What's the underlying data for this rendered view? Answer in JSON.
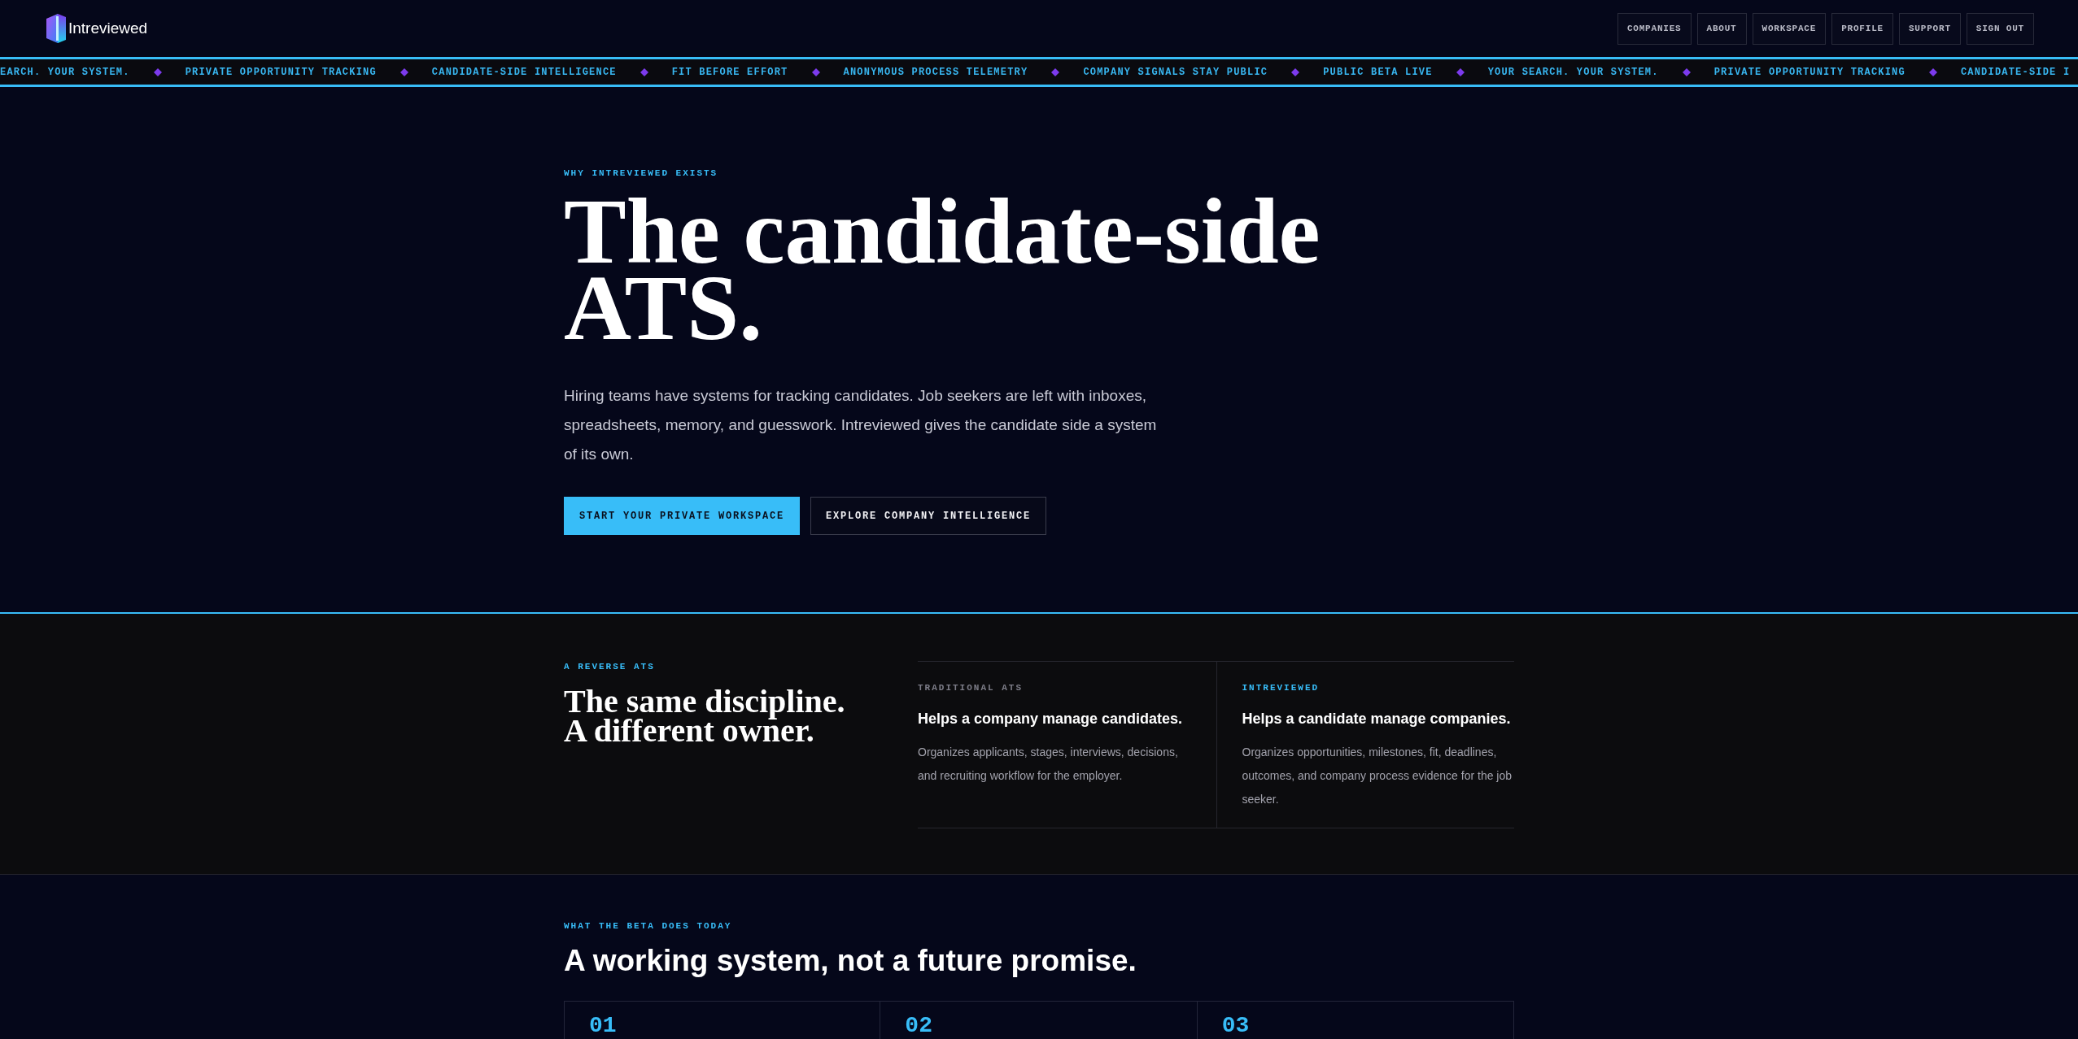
{
  "header": {
    "logo_text": "Intreviewed",
    "nav": [
      {
        "label": "COMPANIES"
      },
      {
        "label": "ABOUT"
      },
      {
        "label": "WORKSPACE"
      },
      {
        "label": "PROFILE"
      },
      {
        "label": "SUPPORT"
      },
      {
        "label": "SIGN OUT"
      }
    ]
  },
  "ticker": [
    "EARCH. YOUR SYSTEM.",
    "PRIVATE OPPORTUNITY TRACKING",
    "CANDIDATE-SIDE INTELLIGENCE",
    "FIT BEFORE EFFORT",
    "ANONYMOUS PROCESS TELEMETRY",
    "COMPANY SIGNALS STAY PUBLIC",
    "PUBLIC BETA LIVE",
    "YOUR SEARCH. YOUR SYSTEM.",
    "PRIVATE OPPORTUNITY TRACKING",
    "CANDIDATE-SIDE I"
  ],
  "hero": {
    "eyebrow": "WHY INTREVIEWED EXISTS",
    "title": "The candidate-side ATS.",
    "body": "Hiring teams have systems for tracking candidates. Job seekers are left with inboxes, spreadsheets, memory, and guesswork. Intreviewed gives the candidate side a system of its own.",
    "buttons": [
      {
        "label": "START YOUR PRIVATE WORKSPACE",
        "kind": "primary"
      },
      {
        "label": "EXPLORE COMPANY INTELLIGENCE",
        "kind": "secondary"
      }
    ]
  },
  "comparison": {
    "eyebrow": "A REVERSE ATS",
    "title": "The same discipline. A different owner.",
    "columns": [
      {
        "kind": "muted",
        "label": "TRADITIONAL ATS",
        "heading": "Helps a company manage candidates.",
        "description": "Organizes applicants, stages, interviews, decisions, and recruiting workflow for the employer."
      },
      {
        "kind": "accent",
        "label": "INTREVIEWED",
        "heading": "Helps a candidate manage companies.",
        "description": "Organizes opportunities, milestones, fit, deadlines, outcomes, and company process evidence for the job seeker."
      }
    ]
  },
  "features": {
    "eyebrow": "WHAT THE BETA DOES TODAY",
    "title": "A working system, not a future promise.",
    "cards": [
      {
        "number": "01"
      },
      {
        "number": "02"
      },
      {
        "number": "03"
      }
    ]
  }
}
